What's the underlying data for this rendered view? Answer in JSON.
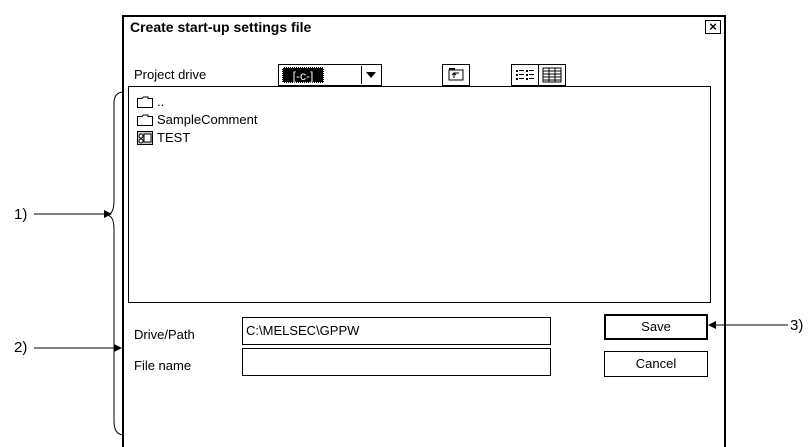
{
  "dialog": {
    "title": "Create start-up settings file",
    "close_label": "×"
  },
  "project_drive": {
    "label": "Project drive",
    "value": "[-c-]"
  },
  "toolbar": {
    "up_folder_icon": "up-folder-icon",
    "list_view_icon": "list-view-icon",
    "details_view_icon": "details-view-icon"
  },
  "file_list": {
    "items": [
      {
        "name": "..",
        "icon": "folder-icon"
      },
      {
        "name": "SampleComment",
        "icon": "folder-icon"
      },
      {
        "name": "TEST",
        "icon": "project-icon"
      }
    ]
  },
  "drive_path": {
    "label": "Drive/Path",
    "value": "C:\\MELSEC\\GPPW"
  },
  "file_name": {
    "label": "File name",
    "value": ""
  },
  "buttons": {
    "save": "Save",
    "cancel": "Cancel"
  },
  "annotations": {
    "a1": "1)",
    "a2": "2)",
    "a3": "3)"
  }
}
